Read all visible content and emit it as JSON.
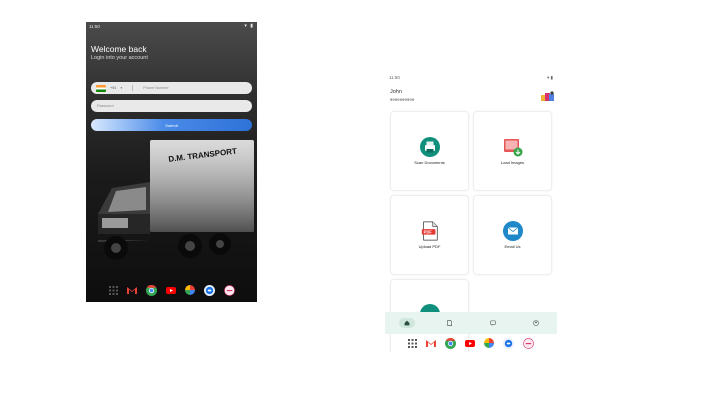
{
  "login_screen": {
    "status_time": "11:50",
    "status_icons": "▾ ▮",
    "welcome_title": "Welcome back",
    "welcome_subtitle": "Login into your account",
    "country_code": "+91",
    "phone_placeholder": "Phone Number",
    "password_placeholder": "Password",
    "submit_label": "Submit",
    "truck_text": "D.M. TRANSPORT"
  },
  "dashboard_screen": {
    "status_time": "11:50",
    "status_icons": "▾ ▮",
    "user_name": "John",
    "user_phone": "9999999999",
    "cards": [
      {
        "label": "Scan Documents",
        "icon": "scanner-icon"
      },
      {
        "label": "Load Images",
        "icon": "load-images-icon"
      },
      {
        "label": "Upload PDF",
        "icon": "pdf-file-icon"
      },
      {
        "label": "Email Us",
        "icon": "email-icon"
      }
    ],
    "bottom_tabs": [
      {
        "icon": "home-icon",
        "active": true
      },
      {
        "icon": "document-icon",
        "active": false
      },
      {
        "icon": "chat-icon",
        "active": false
      },
      {
        "icon": "profile-icon",
        "active": false
      }
    ]
  },
  "taskbar_apps": [
    "apps-grid-icon",
    "gmail-icon",
    "chrome-icon",
    "youtube-icon",
    "photos-icon",
    "messages-icon",
    "extra-app-icon"
  ],
  "colors": {
    "accent_blue": "#2e72d8",
    "teal": "#0f8f7c",
    "nav_background": "#e7f4ef"
  }
}
